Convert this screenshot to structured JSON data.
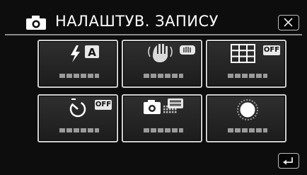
{
  "header": {
    "title": "НАЛАШТУВ. ЗАПИСУ",
    "icon": "camera-icon",
    "close_icon": "close-icon"
  },
  "tiles": [
    {
      "name": "flash",
      "icon": "flash-icon",
      "badge": "A"
    },
    {
      "name": "image-stabilizer",
      "icon": "image-stabilizer-icon"
    },
    {
      "name": "grid",
      "icon": "grid-icon",
      "badge": "OFF"
    },
    {
      "name": "self-timer",
      "icon": "self-timer-icon",
      "badge": "OFF"
    },
    {
      "name": "image-size",
      "icon": "image-size-icon"
    },
    {
      "name": "shutter-mode",
      "icon": "shutter-mode-icon"
    }
  ],
  "footer": {
    "back_icon": "back-return-icon"
  },
  "colors": {
    "background": "#0d0d0d",
    "tile_border": "#cfcfcf",
    "tile_fill": "#262626",
    "badge_fill": "#e8e8e8",
    "text": "#ffffff"
  }
}
